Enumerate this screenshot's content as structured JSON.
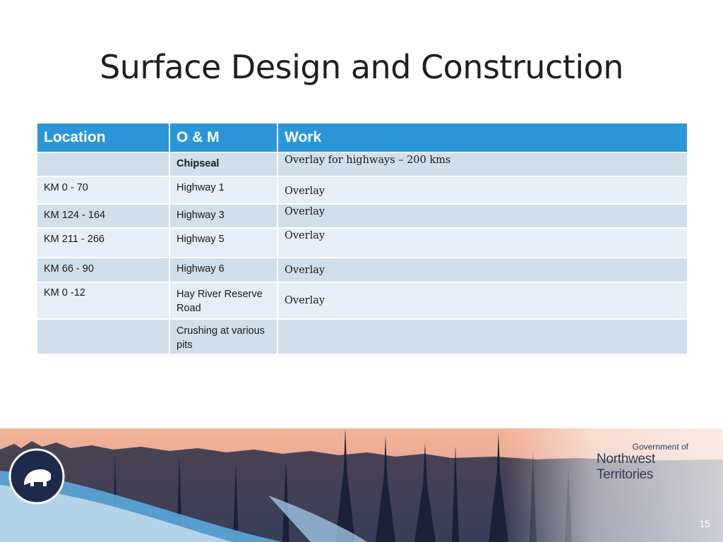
{
  "slide": {
    "title": "Surface Design and Construction",
    "page_number": "15"
  },
  "table": {
    "headers": [
      "Location",
      "O & M",
      "Work"
    ],
    "rows": [
      {
        "location": "",
        "om": "Chipseal",
        "work": "Overlay for highways – 200 kms"
      },
      {
        "location": "KM 0 - 70",
        "om": "Highway 1",
        "work": "Overlay"
      },
      {
        "location": "KM 124 - 164",
        "om": "Highway 3",
        "work": "Overlay"
      },
      {
        "location": "KM 211 - 266",
        "om": "Highway 5",
        "work": "Overlay"
      },
      {
        "location": "KM 66 - 90",
        "om": "Highway 6",
        "work": "Overlay"
      },
      {
        "location": "KM 0 -12",
        "om": "Hay River Reserve Road",
        "work": "Overlay"
      },
      {
        "location": "",
        "om": "Crushing at various pits",
        "work": ""
      }
    ]
  },
  "footer": {
    "gov_line1": "Government of",
    "gov_line2": "Northwest Territories",
    "logo_icon": "polar-bear-icon",
    "accent_color": "#2a96d8"
  }
}
